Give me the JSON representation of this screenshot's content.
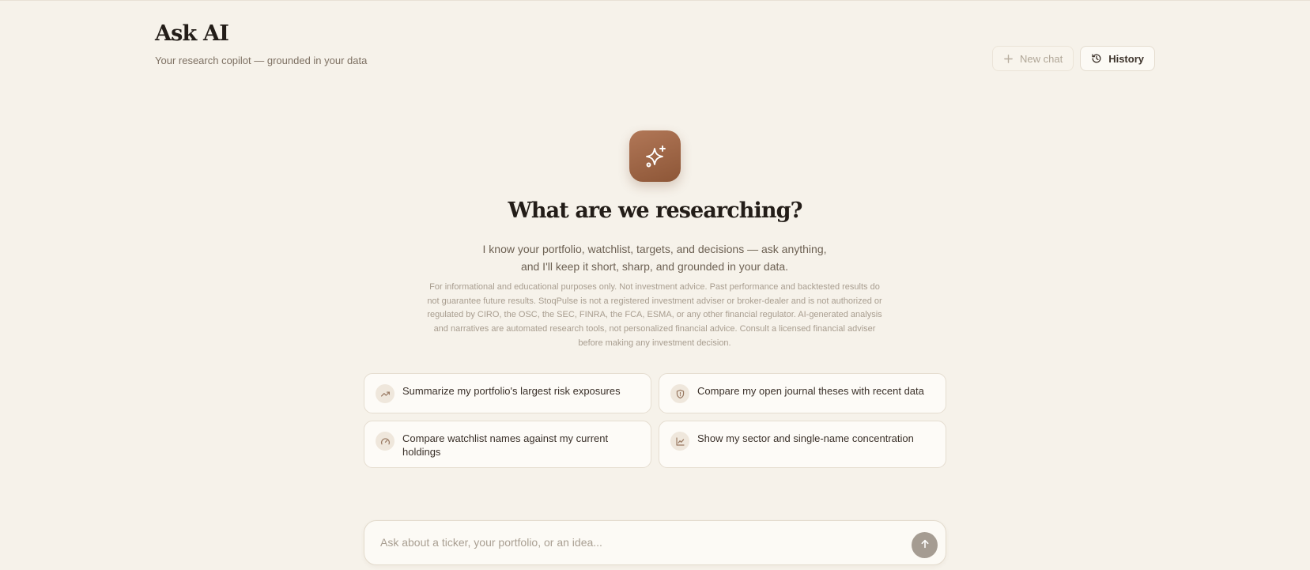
{
  "header": {
    "title": "Ask AI",
    "subtitle": "Your research copilot — grounded in your data"
  },
  "actions": {
    "new_chat_label": "New chat",
    "history_label": "History"
  },
  "hero": {
    "icon": "sparkles-icon",
    "title": "What are we researching?",
    "description_line1": "I know your portfolio, watchlist, targets, and decisions — ask anything,",
    "description_line2": "and I'll keep it short, sharp, and grounded in your data.",
    "disclaimer": "For informational and educational purposes only. Not investment advice. Past performance and backtested results do not guarantee future results. StoqPulse is not a registered investment adviser or broker-dealer and is not authorized or regulated by CIRO, the OSC, the SEC, FINRA, the FCA, ESMA, or any other financial regulator. AI-generated analysis and narratives are automated research tools, not personalized financial advice. Consult a licensed financial adviser before making any investment decision."
  },
  "suggestions": [
    {
      "icon": "trending-up-icon",
      "label": "Summarize my portfolio's largest risk exposures"
    },
    {
      "icon": "shield-icon",
      "label": "Compare my open journal theses with recent data"
    },
    {
      "icon": "gauge-icon",
      "label": "Compare watchlist names against my current holdings"
    },
    {
      "icon": "line-chart-icon",
      "label": "Show my sector and single-name concentration"
    }
  ],
  "composer": {
    "placeholder": "Ask about a ticker, your portfolio, or an idea...",
    "value": ""
  },
  "colors": {
    "background": "#f6f2ea",
    "accent": "#9c6443",
    "send_button": "#a59c92"
  }
}
